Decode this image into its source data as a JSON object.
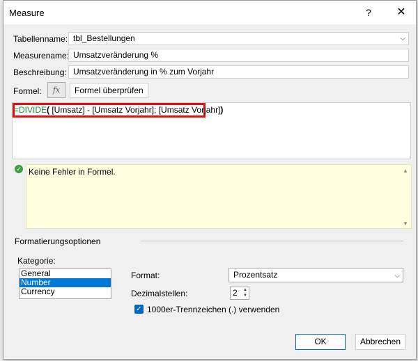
{
  "dialog": {
    "title": "Measure",
    "help_glyph": "?",
    "close_glyph": "✕"
  },
  "fields": {
    "table_label": "Tabellenname:",
    "table_value": "tbl_Bestellungen",
    "measure_label": "Measurename:",
    "measure_value": "Umsatzveränderung %",
    "desc_label": "Beschreibung:",
    "desc_value": "Umsatzveränderung in % zum Vorjahr"
  },
  "formula": {
    "label": "Formel:",
    "fx_glyph": "fx",
    "check_button": "Formel überprüfen",
    "prefix": "=DIVIDE",
    "open_paren": "(",
    "args": " [Umsatz] - [Umsatz Vorjahr];  [Umsatz Vorjahr]",
    "close_paren": ")",
    "highlight_color": "#e01010",
    "keyword_color": "#1a8a3a"
  },
  "status": {
    "message": "Keine Fehler in Formel.",
    "icon": "check-circle-icon"
  },
  "format": {
    "section_title": "Formatierungsoptionen",
    "category_label": "Kategorie:",
    "categories": [
      "General",
      "Number",
      "Currency"
    ],
    "selected_category": "Number",
    "format_label": "Format:",
    "format_value": "Prozentsatz",
    "decimals_label": "Dezimalstellen:",
    "decimals_value": "2",
    "thousands_label": "1000er-Trennzeichen (.) verwenden",
    "thousands_checked": true
  },
  "buttons": {
    "ok": "OK",
    "cancel": "Abbrechen"
  }
}
